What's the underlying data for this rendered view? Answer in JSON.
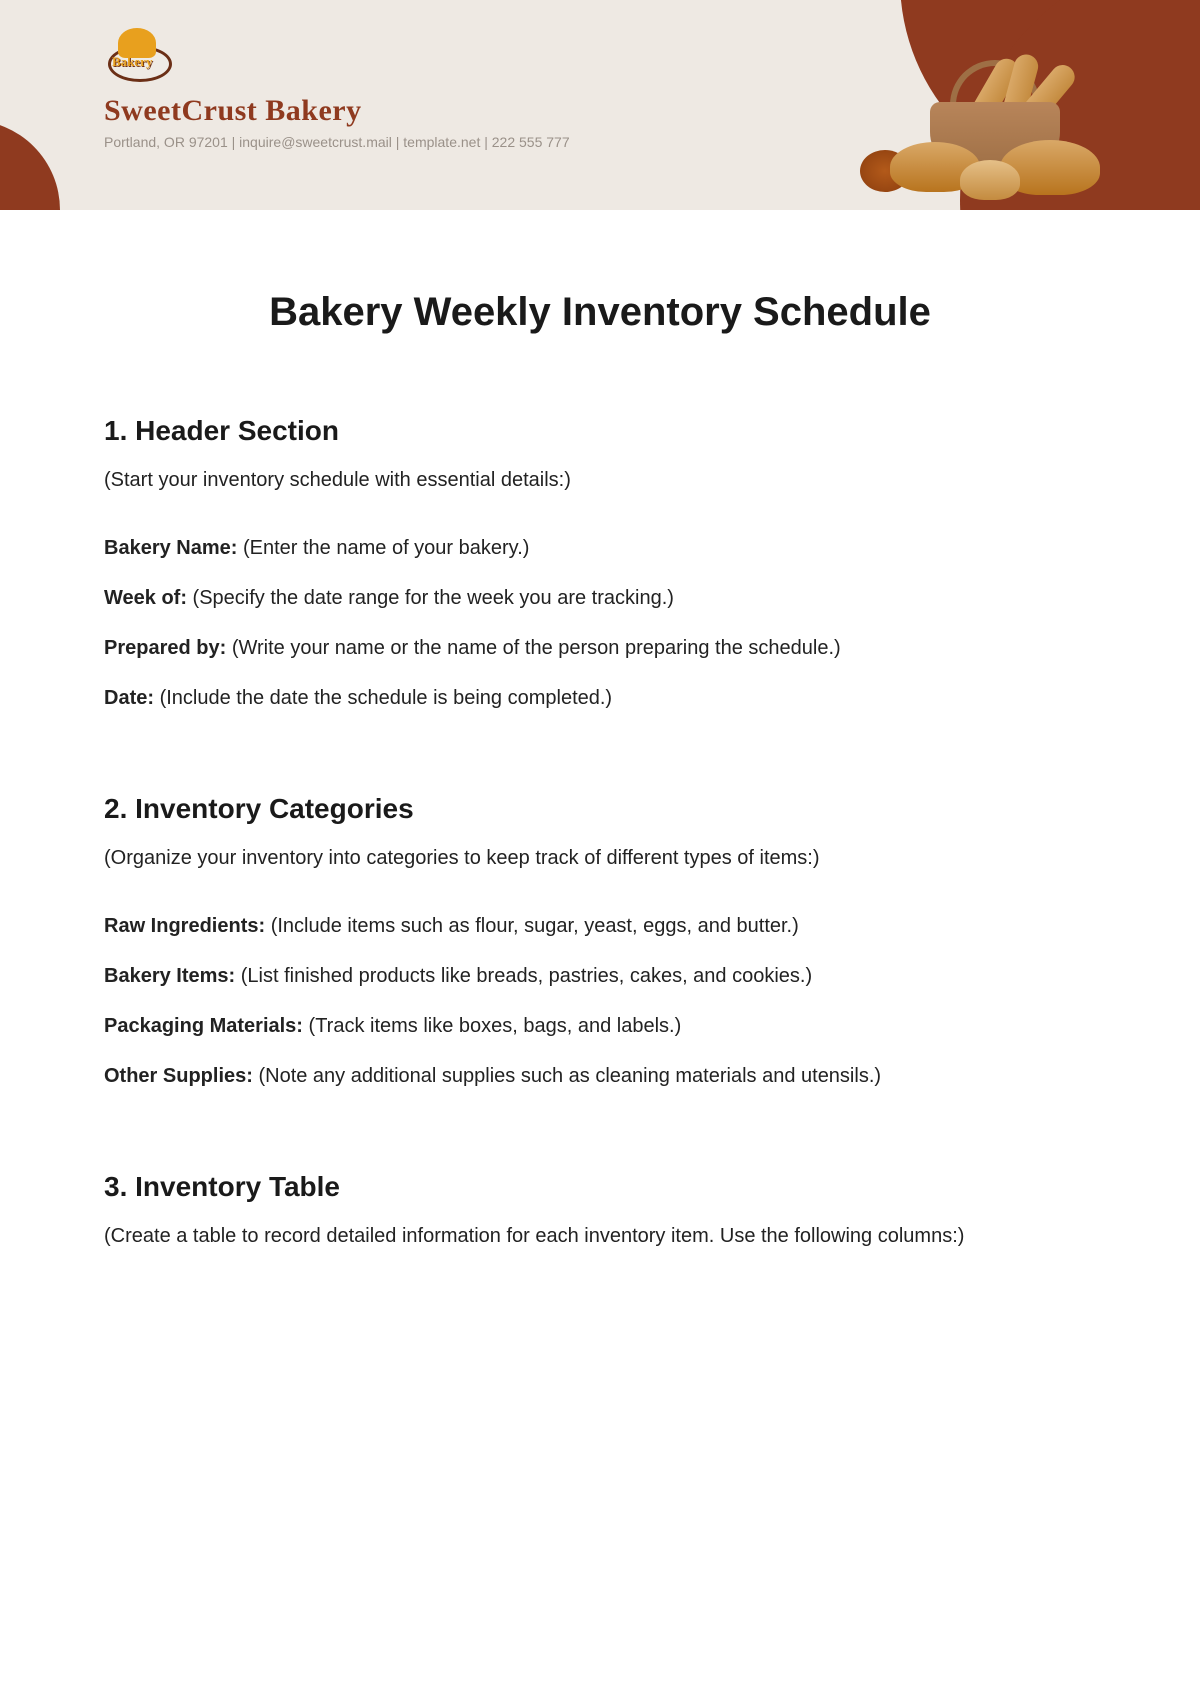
{
  "header": {
    "logo_label": "Bakery",
    "brand_name": "SweetCrust Bakery",
    "subline": "Portland, OR 97201 | inquire@sweetcrust.mail | template.net | 222 555 777"
  },
  "document": {
    "title": "Bakery Weekly Inventory Schedule",
    "sections": [
      {
        "heading": "1. Header Section",
        "intro": "(Start your inventory schedule with essential details:)",
        "fields": [
          {
            "label": "Bakery Name:",
            "value": "(Enter the name of your bakery.)"
          },
          {
            "label": "Week of:",
            "value": "(Specify the date range for the week you are tracking.)"
          },
          {
            "label": "Prepared by:",
            "value": "(Write your name or the name of the person preparing the schedule.)"
          },
          {
            "label": "Date:",
            "value": "(Include the date the schedule is being completed.)"
          }
        ]
      },
      {
        "heading": "2. Inventory Categories",
        "intro": "(Organize your inventory into categories to keep track of different types of items:)",
        "fields": [
          {
            "label": "Raw Ingredients:",
            "value": "(Include items such as flour, sugar, yeast, eggs, and butter.)"
          },
          {
            "label": "Bakery Items:",
            "value": "(List finished products like breads, pastries, cakes, and cookies.)"
          },
          {
            "label": "Packaging Materials:",
            "value": "(Track items like boxes, bags, and labels.)"
          },
          {
            "label": "Other Supplies:",
            "value": "(Note any additional supplies such as cleaning materials and utensils.)"
          }
        ]
      },
      {
        "heading": "3. Inventory Table",
        "intro": "(Create a table to record detailed information for each inventory item. Use the following columns:)",
        "fields": []
      }
    ]
  }
}
